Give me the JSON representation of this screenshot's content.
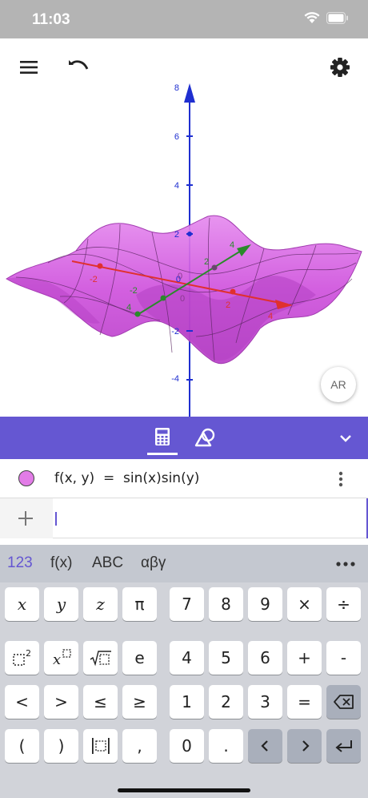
{
  "status_bar": {
    "time": "11:03"
  },
  "graphics": {
    "axis_ticks": {
      "z": [
        "8",
        "6",
        "4",
        "2",
        "0",
        "-2",
        "-4"
      ],
      "y": [
        "2",
        "4",
        "-2"
      ],
      "x": [
        "2",
        "4",
        "-2"
      ],
      "extra": [
        "0",
        "0",
        "4"
      ]
    },
    "ar_label": "AR",
    "colors": {
      "surface": "#d35fe0",
      "surface_edge": "#a23cb0",
      "x_axis": "#e0302f",
      "y_axis": "#2a8a2a",
      "z_axis": "#1f2fd0"
    },
    "icons": [
      "menu-icon",
      "undo-icon",
      "gear-icon"
    ]
  },
  "toolbar": {
    "tabs": [
      {
        "name": "algebra",
        "icon": "calculator-icon",
        "active": true
      },
      {
        "name": "tools",
        "icon": "shapes-icon",
        "active": false
      }
    ],
    "collapse_icon": "chevron-down-icon",
    "color": "#6557d2"
  },
  "algebra": {
    "items": [
      {
        "formula": "f(x, y)  =  sin(x)sin(y)",
        "color": "#e27ce7"
      }
    ],
    "input": {
      "value": "",
      "placeholder": ""
    }
  },
  "keyboard": {
    "tabs": [
      "123",
      "f(x)",
      "ABC",
      "αβγ"
    ],
    "active_tab": "123",
    "more_label": "•••",
    "rows": [
      [
        "x",
        "y",
        "z",
        "π",
        "7",
        "8",
        "9",
        "×",
        "÷"
      ],
      [
        "□²",
        "x□",
        "√□",
        "e",
        "4",
        "5",
        "6",
        "+",
        "-"
      ],
      [
        "<",
        ">",
        "≤",
        "≥",
        "1",
        "2",
        "3",
        "=",
        "⌫"
      ],
      [
        "(",
        ")",
        "|□|",
        ",",
        "0",
        ".",
        "‹",
        "›",
        "↵"
      ]
    ]
  }
}
